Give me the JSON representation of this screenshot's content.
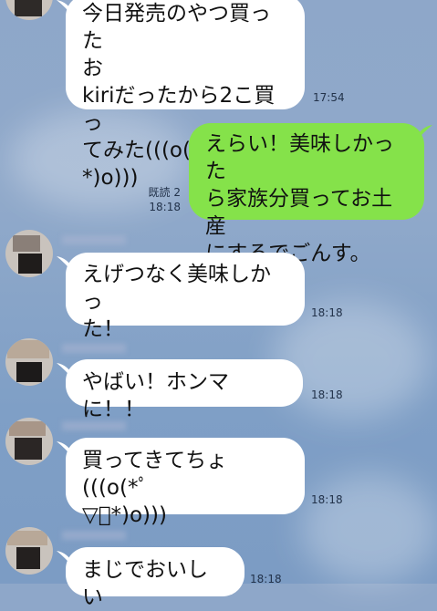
{
  "messages": [
    {
      "id": "m1",
      "sender": "other",
      "text": "今日発売のやつ買った\nお\nkiriだったから2こ買っ\nてみた(((o(*ﾟ▽ﾟ*)o)))",
      "time": "17:54"
    },
    {
      "id": "m2",
      "sender": "me",
      "text": "えらい！美味しかった\nら家族分買ってお土産\nにするでごんす。",
      "read": "既読 2",
      "time": "18:18"
    },
    {
      "id": "m3",
      "sender": "other",
      "text": "えげつなく美味しかっ\nた！",
      "time": "18:18"
    },
    {
      "id": "m4",
      "sender": "other",
      "text": "やばい！ホンマに！！",
      "time": "18:18"
    },
    {
      "id": "m5",
      "sender": "other",
      "text": "買ってきてちょ(((o(*ﾟ\n▽ﾟ*)o)))",
      "time": "18:18"
    },
    {
      "id": "m6",
      "sender": "other",
      "text": "まじでおいしい",
      "time": "18:18"
    }
  ],
  "colors": {
    "own_bubble": "#85e24a",
    "other_bubble": "#ffffff",
    "background": "#8ea7c9"
  }
}
